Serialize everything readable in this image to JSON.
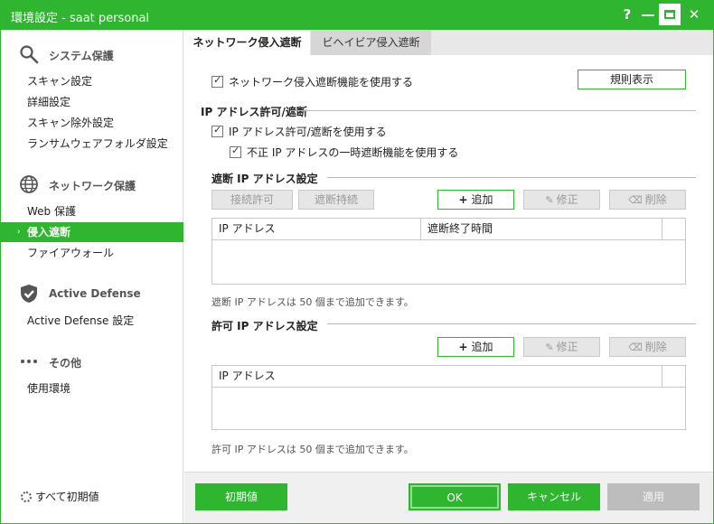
{
  "window": {
    "title": "環境設定 - saat personal",
    "controls": {
      "help": "?",
      "minimize": "—",
      "close": "✕"
    }
  },
  "sidebar": {
    "sections": [
      {
        "icon": "search-icon",
        "label": "システム保護",
        "items": [
          "スキャン設定",
          "詳細設定",
          "スキャン除外設定",
          "ランサムウェアフォルダ設定"
        ]
      },
      {
        "icon": "globe-icon",
        "label": "ネットワーク保護",
        "items": [
          "Web 保護",
          "侵入遮断",
          "ファイアウォール"
        ]
      },
      {
        "icon": "shield-icon",
        "label": "Active Defense",
        "items": [
          "Active Defense 設定"
        ]
      },
      {
        "icon": "more-icon",
        "label": "その他",
        "items": [
          "使用環境"
        ]
      }
    ],
    "active_item": "侵入遮断",
    "reset_all": "すべて初期値"
  },
  "tabs": [
    {
      "label": "ネットワーク侵入遮断",
      "active": true
    },
    {
      "label": "ビヘイビア侵入遮断",
      "active": false
    }
  ],
  "main": {
    "enable_checkbox": {
      "label": "ネットワーク侵入遮断機能を使用する",
      "checked": true
    },
    "rules_button": "規則表示",
    "ip_section": {
      "title": "IP アドレス許可/遮断",
      "use_checkbox": {
        "label": "IP アドレス許可/遮断を使用する",
        "checked": true
      },
      "temp_block_checkbox": {
        "label": "不正 IP アドレスの一時遮断機能を使用する",
        "checked": true
      }
    },
    "block_section": {
      "title": "遮断 IP アドレス設定",
      "btn_allow": "接続許可",
      "btn_keep": "遮断持続",
      "btn_add": "追加",
      "btn_edit": "修正",
      "btn_delete": "削除",
      "columns": [
        "IP アドレス",
        "遮断終了時間"
      ],
      "rows": [],
      "note": "遮断 IP アドレスは 50 個まで追加できます。"
    },
    "allow_section": {
      "title": "許可 IP アドレス設定",
      "btn_add": "追加",
      "btn_edit": "修正",
      "btn_delete": "削除",
      "columns": [
        "IP アドレス"
      ],
      "rows": [],
      "note": "許可 IP アドレスは 50 個まで追加できます。"
    }
  },
  "footer": {
    "defaults": "初期値",
    "ok": "OK",
    "cancel": "キャンセル",
    "apply": "適用"
  },
  "colors": {
    "accent": "#2fb52f",
    "disabled": "#bdbdbd"
  }
}
